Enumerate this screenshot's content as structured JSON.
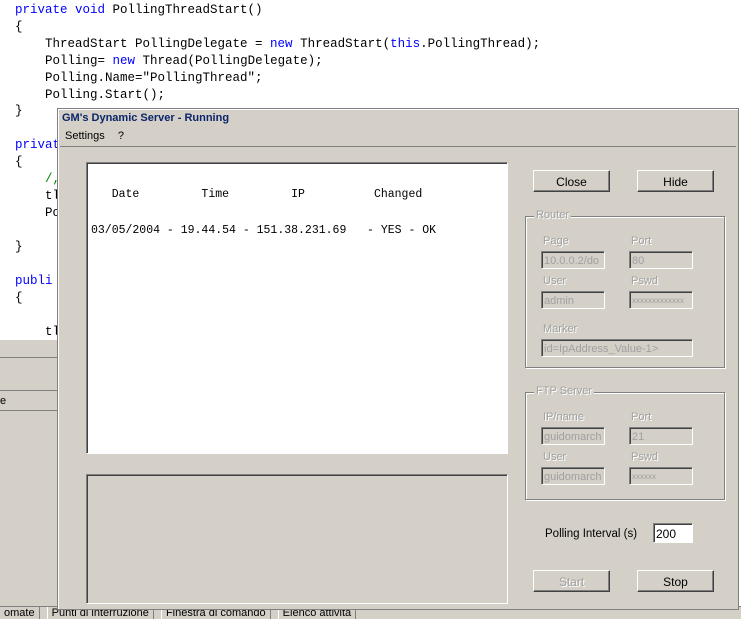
{
  "code": {
    "lines": [
      {
        "t": [
          {
            "k": "kw",
            "v": "private void "
          },
          {
            "k": "",
            "v": "PollingThreadStart()"
          }
        ]
      },
      {
        "t": [
          {
            "k": "",
            "v": "{"
          }
        ]
      },
      {
        "t": [
          {
            "k": "",
            "v": "    ThreadStart PollingDelegate = "
          },
          {
            "k": "kw",
            "v": "new "
          },
          {
            "k": "",
            "v": "ThreadStart("
          },
          {
            "k": "kw",
            "v": "this"
          },
          {
            "k": "",
            "v": ".PollingThread);"
          }
        ]
      },
      {
        "t": [
          {
            "k": "",
            "v": "    Polling= "
          },
          {
            "k": "kw",
            "v": "new "
          },
          {
            "k": "",
            "v": "Thread(PollingDelegate);"
          }
        ]
      },
      {
        "t": [
          {
            "k": "",
            "v": "    Polling.Name=\"PollingThread\";"
          }
        ]
      },
      {
        "t": [
          {
            "k": "",
            "v": "    Polling.Start();"
          }
        ]
      },
      {
        "t": [
          {
            "k": "",
            "v": "}"
          }
        ]
      },
      {
        "t": [
          {
            "k": "",
            "v": ""
          }
        ]
      },
      {
        "t": [
          {
            "k": "kw",
            "v": "privat"
          }
        ]
      },
      {
        "t": [
          {
            "k": "",
            "v": "{"
          }
        ]
      },
      {
        "t": [
          {
            "k": "cm",
            "v": "    /,"
          }
        ]
      },
      {
        "t": [
          {
            "k": "",
            "v": "    tl"
          }
        ]
      },
      {
        "t": [
          {
            "k": "",
            "v": "    Po"
          }
        ]
      },
      {
        "t": [
          {
            "k": "",
            "v": ""
          }
        ]
      },
      {
        "t": [
          {
            "k": "",
            "v": "}"
          }
        ]
      },
      {
        "t": [
          {
            "k": "",
            "v": ""
          }
        ]
      },
      {
        "t": [
          {
            "k": "kw",
            "v": "publi"
          }
        ]
      },
      {
        "t": [
          {
            "k": "",
            "v": "{"
          }
        ]
      },
      {
        "t": [
          {
            "k": "",
            "v": ""
          }
        ]
      },
      {
        "t": [
          {
            "k": "",
            "v": "    tl"
          }
        ]
      }
    ]
  },
  "ide": {
    "side_label": "e",
    "taskbar": [
      "omate",
      "Punti di interruzione",
      "Finestra di comando",
      "Elenco attività"
    ]
  },
  "dialog": {
    "title": "GM's Dynamic Server - Running",
    "menu": [
      "Settings",
      "?"
    ],
    "log": {
      "header": "   Date         Time         IP          Changed",
      "rows": [
        "03/05/2004 - 19.44.54 - 151.38.231.69   - YES - OK"
      ]
    },
    "buttons": {
      "close": "Close",
      "hide": "Hide",
      "start": "Start",
      "stop": "Stop"
    },
    "router": {
      "title": "Router",
      "page_label": "Page",
      "page_value": "10.0.0.2/do",
      "port_label": "Port",
      "port_value": "80",
      "user_label": "User",
      "user_value": "admin",
      "pswd_label": "Pswd",
      "pswd_value": "xxxxxxxxxxxxx",
      "marker_label": "Marker",
      "marker_value": "id=IpAddress_Value-1>"
    },
    "ftp": {
      "title": "FTP Server",
      "ip_label": "IP/name",
      "ip_value": "guidomarch",
      "port_label": "Port",
      "port_value": "21",
      "user_label": "User",
      "user_value": "guidomarch",
      "pswd_label": "Pswd",
      "pswd_value": "xxxxxx"
    },
    "polling": {
      "label": "Polling Interval (s)",
      "value": "200"
    }
  }
}
